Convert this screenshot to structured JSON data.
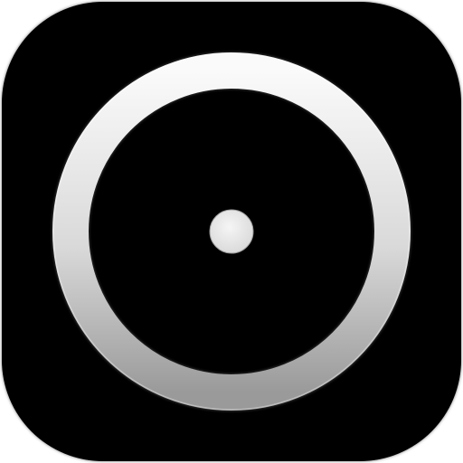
{
  "icon": {
    "name": "circle-with-center-dot",
    "background_color": "#000000",
    "ring_color_light": "#fafafa",
    "ring_color_mid": "#d9d9d9",
    "ring_color_dark": "#9a9a9a",
    "dot_color": "#d8d8d8"
  }
}
